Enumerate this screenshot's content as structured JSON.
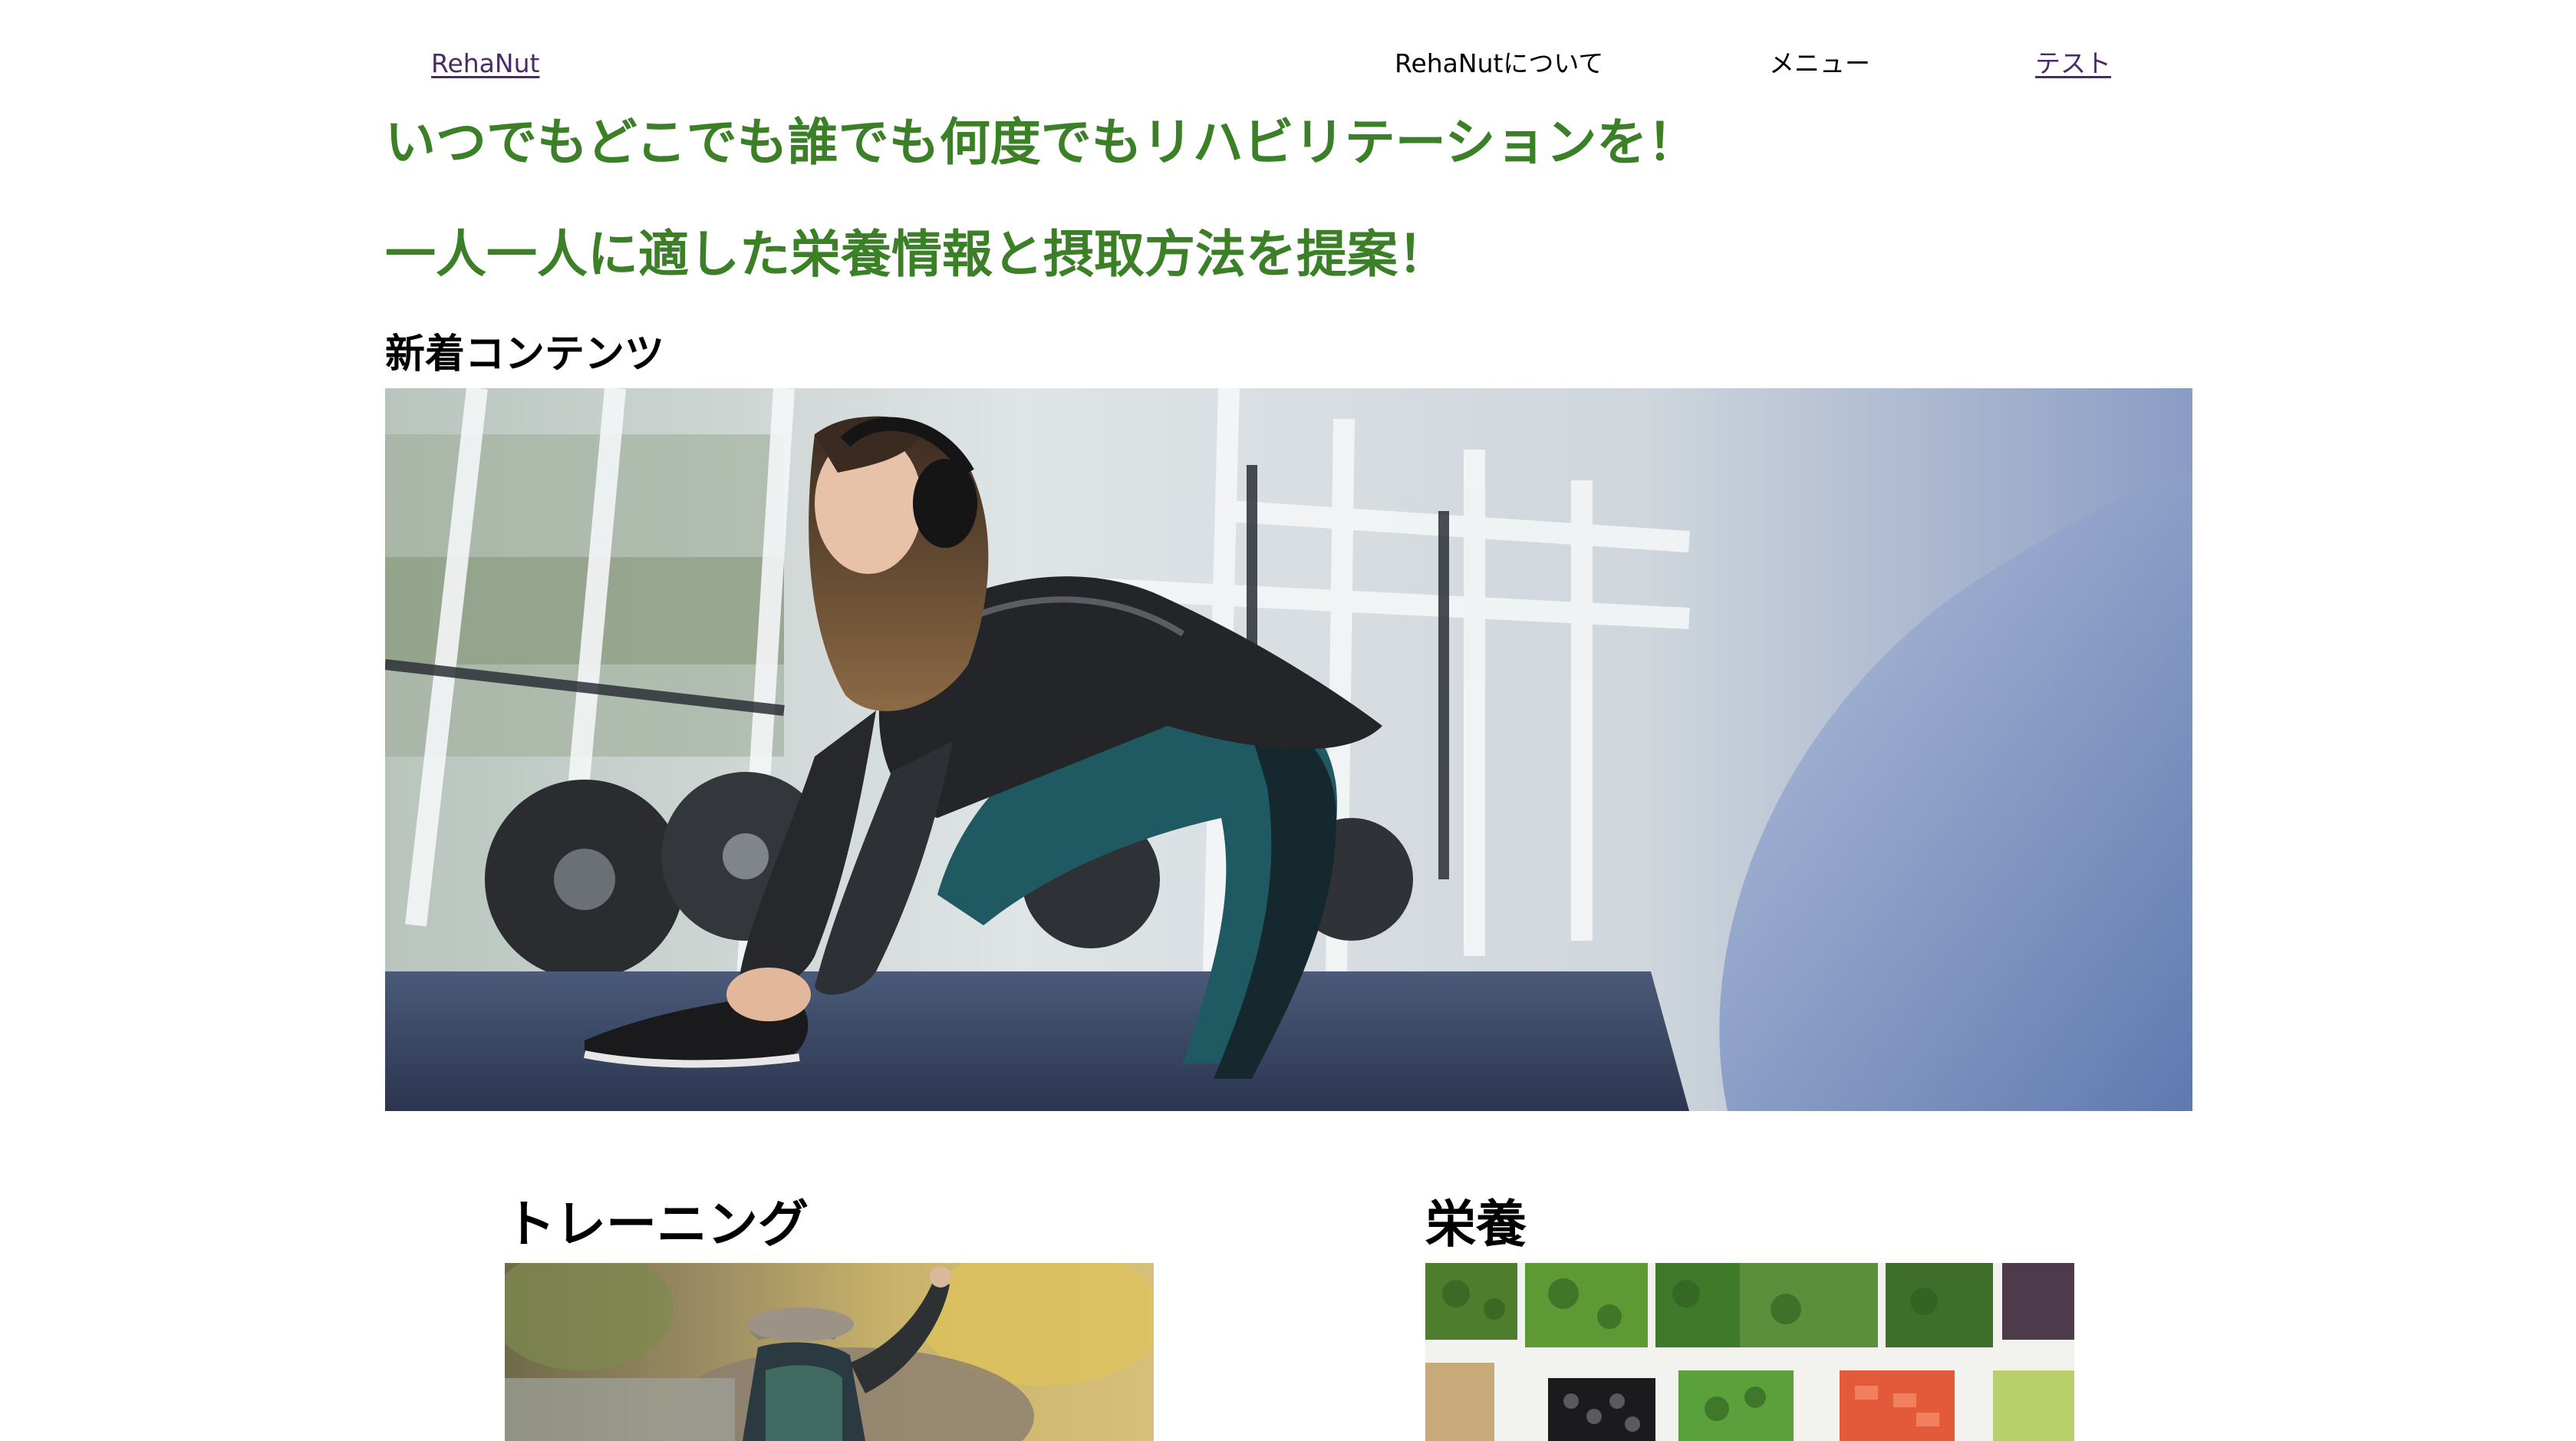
{
  "nav": {
    "logo": "RehaNut",
    "about": "RehaNutについて",
    "menu": "メニュー",
    "test": "テスト"
  },
  "hero": {
    "tagline_1": "いつでもどこでも誰でも何度でもリハビリテーションを！",
    "tagline_2": "一人一人に適した栄養情報と摂取方法を提案！"
  },
  "new_content": {
    "heading": "新着コンテンツ",
    "image": "woman-tying-shoe-in-gym-photo"
  },
  "cards": [
    {
      "title": "トレーニング",
      "image": "hiker-on-trail-photo"
    },
    {
      "title": "栄養",
      "image": "vegetable-bowls-photo"
    }
  ],
  "colors": {
    "tagline": "#3b8026",
    "visited_link": "#4b2a68",
    "text": "#000000",
    "background": "#ffffff"
  }
}
